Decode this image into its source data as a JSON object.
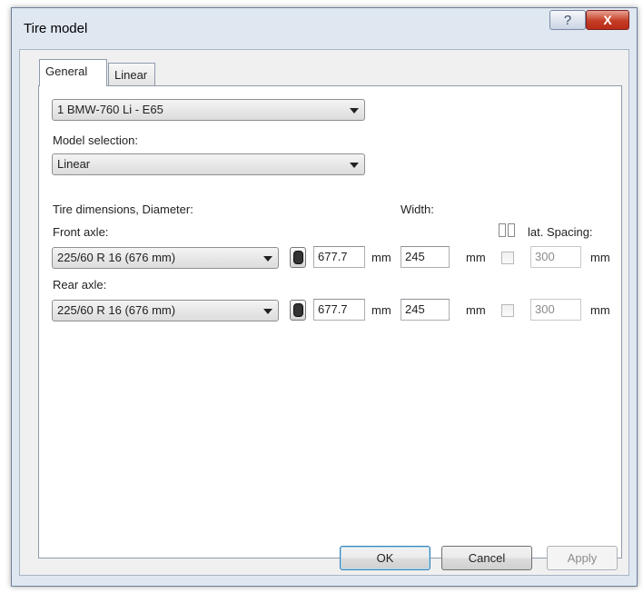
{
  "window": {
    "title": "Tire model",
    "help_glyph": "?",
    "close_glyph": "X"
  },
  "tabs": [
    {
      "label": "General",
      "active": true
    },
    {
      "label": "Linear",
      "active": false
    }
  ],
  "vehicle_select": {
    "value": "1  BMW-760 Li - E65"
  },
  "model_selection": {
    "label": "Model selection:",
    "value": "Linear"
  },
  "dimensions": {
    "header_label": "Tire dimensions, Diameter:",
    "width_label": "Width:",
    "lat_spacing_label": "lat. Spacing:",
    "icons": {
      "tire": "tire-icon",
      "dual_tire": "dual-tire-icon"
    }
  },
  "front_axle": {
    "label": "Front axle:",
    "tire_size": "225/60 R 16 (676 mm)",
    "diameter": "677.7",
    "diameter_unit": "mm",
    "width": "245",
    "width_unit": "mm",
    "dual_checked": false,
    "lat_spacing": "300",
    "lat_spacing_unit": "mm"
  },
  "rear_axle": {
    "label": "Rear axle:",
    "tire_size": "225/60 R 16 (676 mm)",
    "diameter": "677.7",
    "diameter_unit": "mm",
    "width": "245",
    "width_unit": "mm",
    "dual_checked": false,
    "lat_spacing": "300",
    "lat_spacing_unit": "mm"
  },
  "buttons": {
    "ok": "OK",
    "cancel": "Cancel",
    "apply": "Apply"
  },
  "colors": {
    "close_button": "#c43d25",
    "frame": "#dfe7f1"
  }
}
